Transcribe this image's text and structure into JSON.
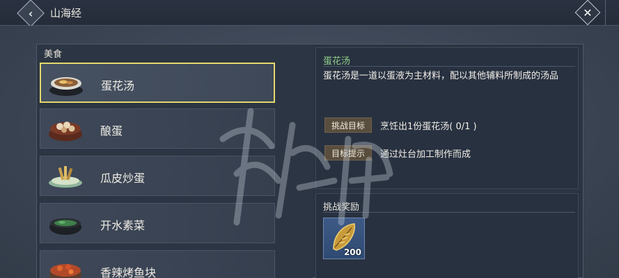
{
  "window": {
    "title": "山海经"
  },
  "category": {
    "label": "美食"
  },
  "items": [
    {
      "name": "蛋花汤",
      "icon": "egg-soup-bowl-icon",
      "selected": true
    },
    {
      "name": "酿蛋",
      "icon": "stuffed-egg-dish-icon",
      "selected": false
    },
    {
      "name": "瓜皮炒蛋",
      "icon": "melon-rind-egg-icon",
      "selected": false
    },
    {
      "name": "开水素菜",
      "icon": "vegetable-soup-icon",
      "selected": false
    },
    {
      "name": "香辣烤鱼块",
      "icon": "spicy-fish-icon",
      "selected": false
    }
  ],
  "detail": {
    "title": "蛋花汤",
    "description": "蛋花汤是一道以蛋液为主材料，配以其他辅料所制成的汤品",
    "goal_label": "挑战目标",
    "goal_value": "烹饪出1份蛋花汤( 0/1 )",
    "hint_label": "目标提示",
    "hint_value": "通过灶台加工制作而成"
  },
  "reward": {
    "title": "挑战奖励",
    "icon": "gold-feather-token-icon",
    "count": "200"
  },
  "colors": {
    "selected_border": "#e4d86c",
    "title_green": "#8fd08a",
    "tag_bg": "#594e3e",
    "reward_slot": "#3d5a86"
  }
}
